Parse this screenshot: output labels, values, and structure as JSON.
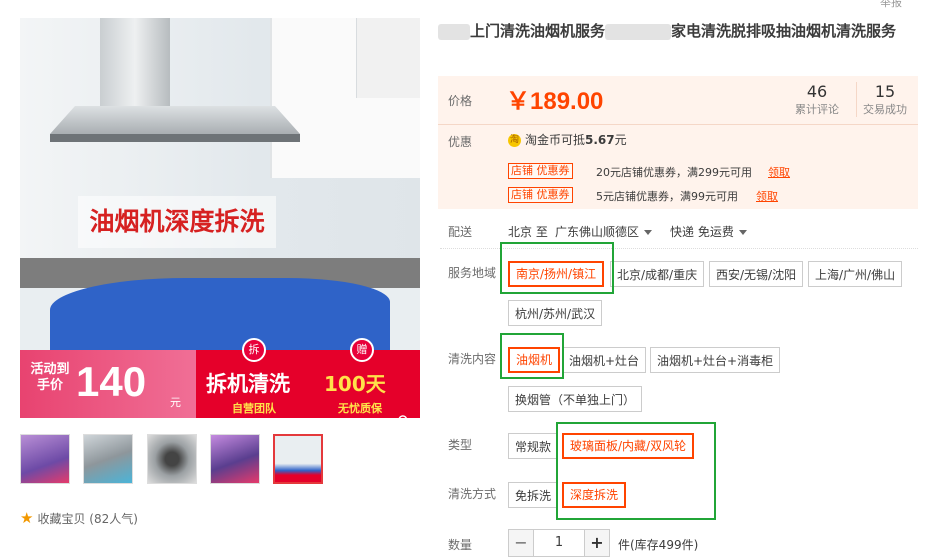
{
  "report_link": "举报",
  "title": {
    "part1": "上门清洗油烟机服务",
    "part2": "家电清洗脱排吸抽油烟机清洗服务"
  },
  "main_image": {
    "overlay_text": "油烟机深度拆洗",
    "promo": {
      "activity": "活动到手价",
      "price_number": "140",
      "price_unit": "元",
      "badge_left": "拆",
      "main": "拆机清洗",
      "main_sub": "自营团队",
      "badge_right": "赠",
      "right": "100天",
      "right_sub": "无忧质保"
    }
  },
  "thumbnails_count": 5,
  "favorite": {
    "label": "收藏宝贝",
    "popularity": "(82人气)"
  },
  "price_section": {
    "price_label": "价格",
    "price": "￥189.00",
    "reviews_count": "46",
    "reviews_label": "累计评论",
    "deals_count": "15",
    "deals_label": "交易成功",
    "discount_label": "优惠",
    "coin_icon": "淘",
    "coin_text": "淘金币可抵",
    "coin_amount": "5.67",
    "coin_unit": "元",
    "coupons": [
      {
        "tag": "店铺 优惠券",
        "text": "20元店铺优惠券，满299元可用",
        "link": "领取"
      },
      {
        "tag": "店铺 优惠券",
        "text": "5元店铺优惠券，满99元可用",
        "link": "领取"
      }
    ]
  },
  "delivery": {
    "label": "配送",
    "from": "北京 至",
    "to": "广东佛山顺德区",
    "shipping": "快递 免运费"
  },
  "service_area": {
    "label": "服务地域",
    "options": [
      "南京/扬州/镇江",
      "北京/成都/重庆",
      "西安/无锡/沈阳",
      "上海/广州/佛山",
      "杭州/苏州/武汉"
    ],
    "selected": 0
  },
  "clean_content": {
    "label": "清洗内容",
    "options": [
      "油烟机",
      "油烟机+灶台",
      "油烟机+灶台+消毒柜",
      "换烟管（不单独上门）"
    ],
    "selected": 0
  },
  "type": {
    "label": "类型",
    "options": [
      "常规款",
      "玻璃面板/内藏/双风轮"
    ],
    "selected": 1
  },
  "clean_method": {
    "label": "清洗方式",
    "options": [
      "免拆洗",
      "深度拆洗"
    ],
    "selected": 1
  },
  "quantity": {
    "label": "数量",
    "minus": "−",
    "value": "1",
    "plus": "+",
    "stock": "件(库存499件)"
  },
  "colors": {
    "accent": "#ff4400",
    "highlight_box": "#21a537",
    "promo_red": "#e5002a"
  }
}
